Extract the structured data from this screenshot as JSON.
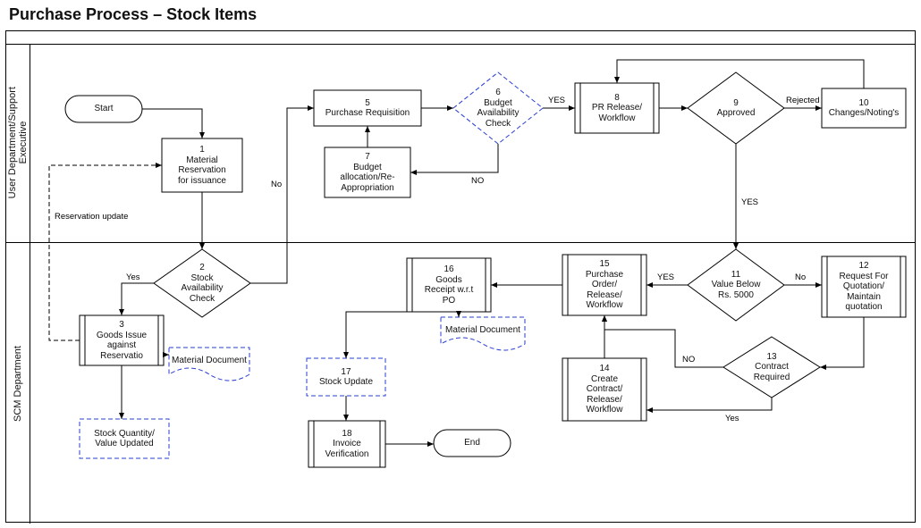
{
  "title": "Purchase Process – Stock Items",
  "lanes": {
    "user": "User Department/Support\nExecutive",
    "scm": "SCM Department"
  },
  "nodes": {
    "start": "Start",
    "n1": "1\nMaterial\nReservation\nfor issuance",
    "n2": "2\nStock\nAvailability\nCheck",
    "n3": "3\nGoods Issue\nagainst\nReservatio",
    "d3": "Material Document",
    "d3b": "Stock Quantity/\nValue Updated",
    "n5": "5\nPurchase Requisition",
    "n6": "6\nBudget\nAvailability\nCheck",
    "n7": "7\nBudget\nallocation/Re-\nAppropriation",
    "n8": "8\nPR Release/\nWorkflow",
    "n9": "9\nApproved",
    "n10": "10\nChanges/Noting's",
    "n11": "11\nValue Below\nRs. 5000",
    "n12": "12\nRequest For\nQuotation/\nMaintain\nquotation",
    "n13": "13\nContract\nRequired",
    "n14": "14\nCreate\nContract/\nRelease/\nWorkflow",
    "n15": "15\nPurchase\nOrder/\nRelease/\nWorkflow",
    "n16": "16\nGoods\nReceipt w.r.t\nPO",
    "d16": "Material Document",
    "n17": "17\nStock Update",
    "n18": "18\nInvoice\nVerification",
    "end": "End"
  },
  "edges": {
    "res_update": "Reservation update",
    "yes": "Yes",
    "no": "No",
    "YES": "YES",
    "NO": "NO",
    "rejected": "Rejected"
  }
}
